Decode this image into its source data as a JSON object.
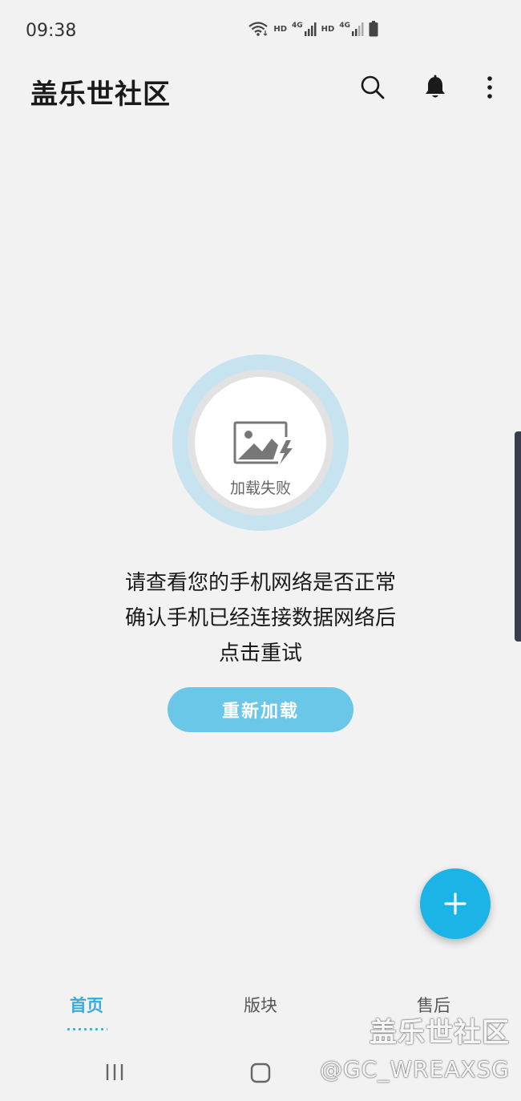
{
  "status_bar": {
    "time": "09:38",
    "hd1": "HD",
    "net1": "4G",
    "hd2": "HD",
    "net2": "4G",
    "icons": [
      "wifi-icon",
      "signal-icon",
      "signal-icon",
      "battery-icon"
    ]
  },
  "app_bar": {
    "title": "盖乐世社区",
    "actions": [
      "search-icon",
      "bell-icon",
      "more-vert-icon"
    ]
  },
  "error": {
    "caption": "加载失败",
    "icon": "broken-image-icon",
    "message_lines": [
      "请查看您的手机网络是否正常",
      "确认手机已经连接数据网络后",
      "点击重试"
    ],
    "retry_label": "重新加载"
  },
  "fab": {
    "icon": "plus-icon"
  },
  "bottom_nav": {
    "items": [
      {
        "label": "首页",
        "active": true
      },
      {
        "label": "版块",
        "active": false
      },
      {
        "label": "售后",
        "active": false
      }
    ]
  },
  "watermark": {
    "title": "盖乐世社区",
    "handle": "@GC_WREAXSG"
  },
  "colors": {
    "accent": "#6ac7e8",
    "fab": "#1cb3e6",
    "active_tab": "#3aabd8",
    "background": "#f2f2f2"
  }
}
